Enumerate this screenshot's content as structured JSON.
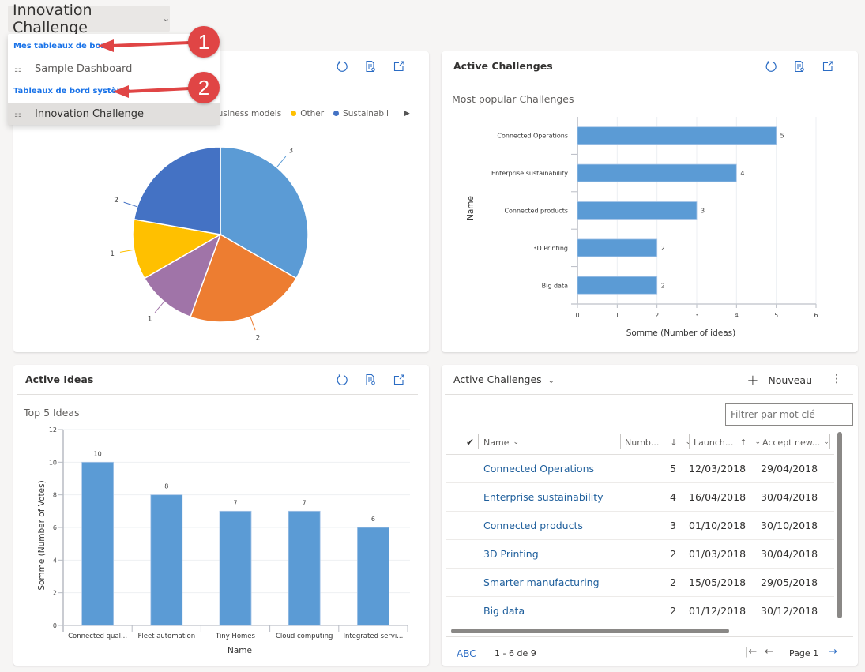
{
  "dashboard": {
    "title": "Innovation Challenge",
    "chevron_icon": "chevron-down"
  },
  "dashboard_menu": {
    "groups": [
      {
        "label": "Mes tableaux de bord",
        "items": [
          {
            "label": "Sample Dashboard",
            "icon": "dashboard-icon",
            "selected": false
          }
        ]
      },
      {
        "label": "Tableaux de bord système",
        "items": [
          {
            "label": "Innovation Challenge",
            "icon": "dashboard-icon",
            "selected": true
          }
        ]
      }
    ],
    "annotations": [
      "1",
      "2"
    ],
    "annotation_color": "#e04545"
  },
  "cards": {
    "pie": {
      "legend": [
        {
          "label": "w business models",
          "color": "#ed7d31"
        },
        {
          "label": "Other",
          "color": "#ffc000"
        },
        {
          "label": "Sustainabil",
          "color": "#4472c4"
        }
      ],
      "legend_next_icon": "▶"
    },
    "challenges_chart": {
      "title": "Active Challenges",
      "subtitle": "Most popular Challenges"
    },
    "ideas_chart": {
      "title": "Active Ideas",
      "subtitle": "Top 5 Ideas"
    },
    "challenges_grid": {
      "title": "Active Challenges",
      "new_label": "Nouveau",
      "more_icon": "⋮",
      "filter_placeholder": "Filtrer par mot clé",
      "columns": [
        {
          "label": "Name",
          "sort": ""
        },
        {
          "label": "Numb...",
          "sort": "↓"
        },
        {
          "label": "Launch...",
          "sort": "↑"
        },
        {
          "label": "Accept new...",
          "sort": ""
        }
      ],
      "rows": [
        {
          "name": "Connected Operations",
          "number": "5",
          "launch": "12/03/2018",
          "accept": "29/04/2018"
        },
        {
          "name": "Enterprise sustainability",
          "number": "4",
          "launch": "16/04/2018",
          "accept": "30/04/2018"
        },
        {
          "name": "Connected products",
          "number": "3",
          "launch": "01/10/2018",
          "accept": "30/10/2018"
        },
        {
          "name": "3D Printing",
          "number": "2",
          "launch": "01/03/2018",
          "accept": "30/04/2018"
        },
        {
          "name": "Smarter manufacturing",
          "number": "2",
          "launch": "15/05/2018",
          "accept": "29/05/2018"
        },
        {
          "name": "Big data",
          "number": "2",
          "launch": "01/12/2018",
          "accept": "30/12/2018"
        }
      ],
      "footer": {
        "abc": "ABC",
        "range": "1 - 6 de 9",
        "page": "Page 1",
        "first_icon": "|←",
        "prev_icon": "←",
        "next_icon": "→"
      }
    }
  },
  "chart_data": [
    {
      "type": "pie",
      "title": "",
      "slices": [
        {
          "label": "(hidden)",
          "value": 3,
          "color": "#5b9bd5"
        },
        {
          "label": "New business models",
          "value": 2,
          "color": "#ed7d31"
        },
        {
          "label": "(hidden)",
          "value": 1,
          "color": "#a074a8"
        },
        {
          "label": "Other",
          "value": 1,
          "color": "#ffc000"
        },
        {
          "label": "Sustainability",
          "value": 2,
          "color": "#4472c4"
        }
      ],
      "legend_position": "top"
    },
    {
      "type": "bar",
      "orientation": "horizontal",
      "title": "Most popular Challenges",
      "categories": [
        "Connected Operations",
        "Enterprise sustainability",
        "Connected products",
        "3D Printing",
        "Big data"
      ],
      "values": [
        5,
        4,
        3,
        2,
        2
      ],
      "xlabel": "Somme (Number of ideas)",
      "ylabel": "Name",
      "xlim": [
        0,
        6
      ],
      "xticks": [
        0,
        1,
        2,
        3,
        4,
        5,
        6
      ],
      "grid": true,
      "color": "#5b9bd5"
    },
    {
      "type": "bar",
      "orientation": "vertical",
      "title": "Top 5 Ideas",
      "categories": [
        "Connected qual...",
        "Fleet automation",
        "Tiny Homes",
        "Cloud computing",
        "Integrated servi..."
      ],
      "values": [
        10,
        8,
        7,
        7,
        6
      ],
      "xlabel": "Name",
      "ylabel": "Somme (Number of Votes)",
      "ylim": [
        0,
        12
      ],
      "yticks": [
        0,
        2,
        4,
        6,
        8,
        10,
        12
      ],
      "grid": true,
      "color": "#5b9bd5"
    }
  ]
}
